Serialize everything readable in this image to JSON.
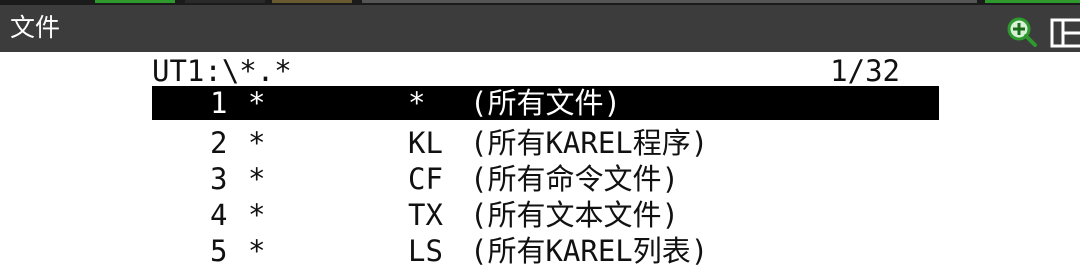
{
  "window": {
    "title": "文件",
    "zoom_icon": "zoom-in-icon",
    "split_icon": "split-screen-icon"
  },
  "colors": {
    "titlebar": "#3c3c3c",
    "selected_row": "#000000",
    "accent_green": "#2e9a2e"
  },
  "list": {
    "path": "UT1:\\*.*",
    "page": "1/32",
    "rows": [
      {
        "num": "1",
        "star": "*",
        "ext": "*",
        "desc": "(所有文件)",
        "selected": true
      },
      {
        "num": "2",
        "star": "*",
        "ext": "KL",
        "desc": "(所有KAREL程序)",
        "selected": false
      },
      {
        "num": "3",
        "star": "*",
        "ext": "CF",
        "desc": "(所有命令文件)",
        "selected": false
      },
      {
        "num": "4",
        "star": "*",
        "ext": "TX",
        "desc": "(所有文本文件)",
        "selected": false
      },
      {
        "num": "5",
        "star": "*",
        "ext": "LS",
        "desc": "(所有KAREL列表)",
        "selected": false
      }
    ]
  }
}
